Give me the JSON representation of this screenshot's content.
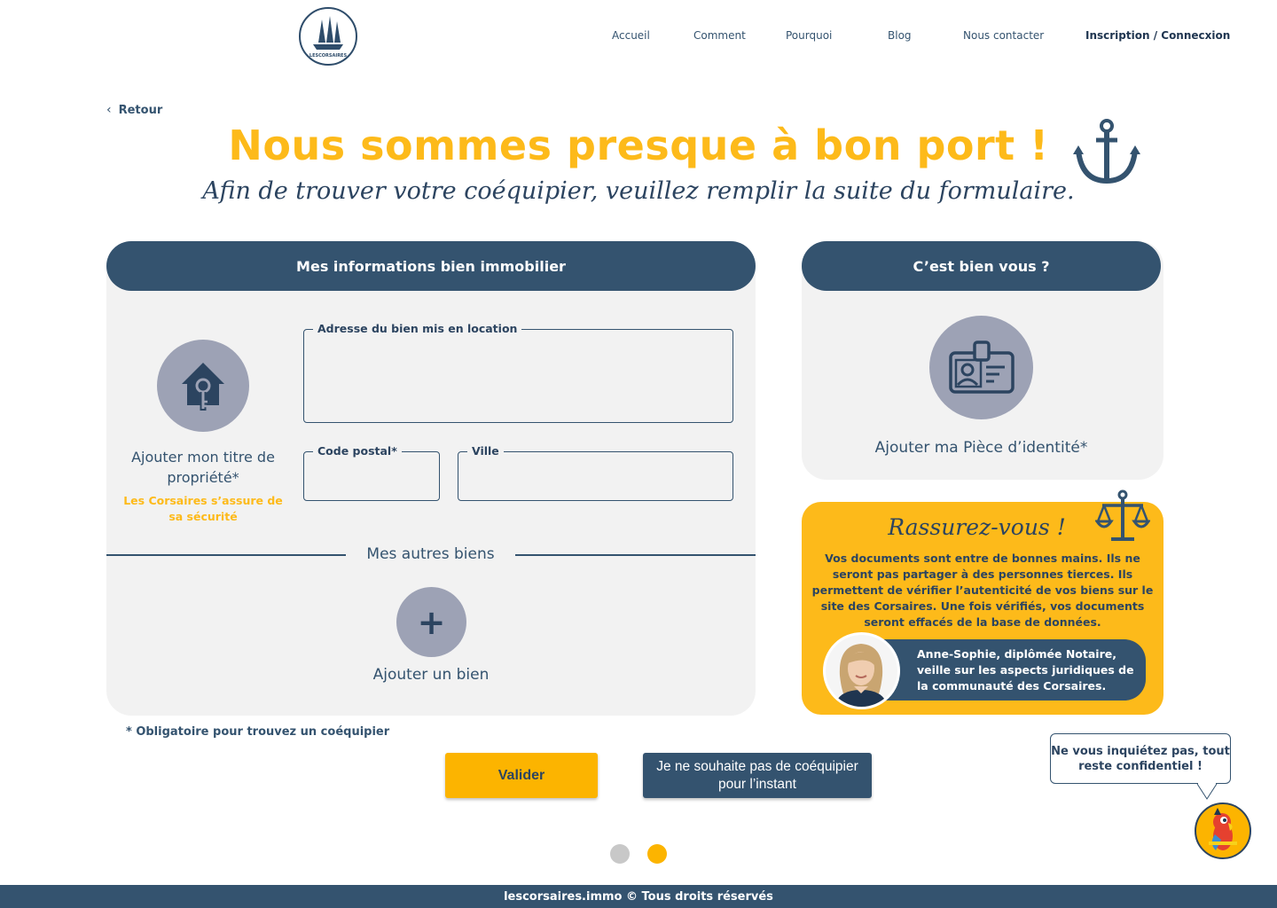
{
  "header": {
    "logo_text": "LESCORSAIRES",
    "nav": [
      {
        "label": "Accueil"
      },
      {
        "label": "Comment"
      },
      {
        "label": "Pourquoi"
      },
      {
        "label": "Blog"
      },
      {
        "label": "Nous contacter"
      },
      {
        "label": "Inscription / Connecxion"
      }
    ]
  },
  "back": {
    "label": "Retour",
    "icon": "chevron-left-icon"
  },
  "hero": {
    "title": "Nous sommes presque à bon port !",
    "subtitle": "Afin de trouver votre coéquipier, veuillez remplir la suite du formulaire.",
    "icon": "anchor-icon"
  },
  "property_card": {
    "header": "Mes informations bien immobilier",
    "title_deed": {
      "label": "Ajouter mon titre de propriété*",
      "note": "Les Corsaires s’assure de sa sécurité",
      "icon": "house-key-icon"
    },
    "fields": {
      "address": {
        "label": "Adresse du bien mis en location",
        "value": ""
      },
      "postal_code": {
        "label": "Code postal*",
        "value": ""
      },
      "city": {
        "label": "Ville",
        "value": ""
      }
    },
    "other_properties": {
      "label": "Mes autres biens",
      "add_label": "Ajouter un bien",
      "icon": "plus-icon"
    }
  },
  "identity_card": {
    "header": "C’est bien vous ?",
    "label": "Ajouter ma Pièce d’identité*",
    "icon": "id-card-icon"
  },
  "reassure_card": {
    "title": "Rassurez-vous !",
    "text": "Vos documents sont entre de bonnes mains. Ils ne seront pas partager à des personnes tierces. Ils permettent de vérifier l’autenticité de vos biens sur le site des Corsaires. Une fois vérifiés, vos documents seront effacés de la base de données.",
    "notary_text": "Anne-Sophie, diplômée Notaire, veille sur les aspects juridiques de la communauté des Corsaires.",
    "icon": "scale-icon"
  },
  "mandatory_note": "* Obligatoire pour trouvez un coéquipier",
  "buttons": {
    "validate": "Valider",
    "skip": "Je ne souhaite pas de coéquipier pour l’instant"
  },
  "pagination": {
    "current": 2,
    "total": 2
  },
  "helper": {
    "bubble": "Ne vous inquiétez pas, tout reste confidentiel !",
    "icon": "parrot-mascot-icon"
  },
  "footer": {
    "text": "lescorsaires.immo © Tous droits réservés"
  },
  "colors": {
    "navy": "#34536f",
    "yellow": "#fdba1a",
    "grey_bg": "#f2f2f2",
    "circle": "#9da2b5"
  }
}
